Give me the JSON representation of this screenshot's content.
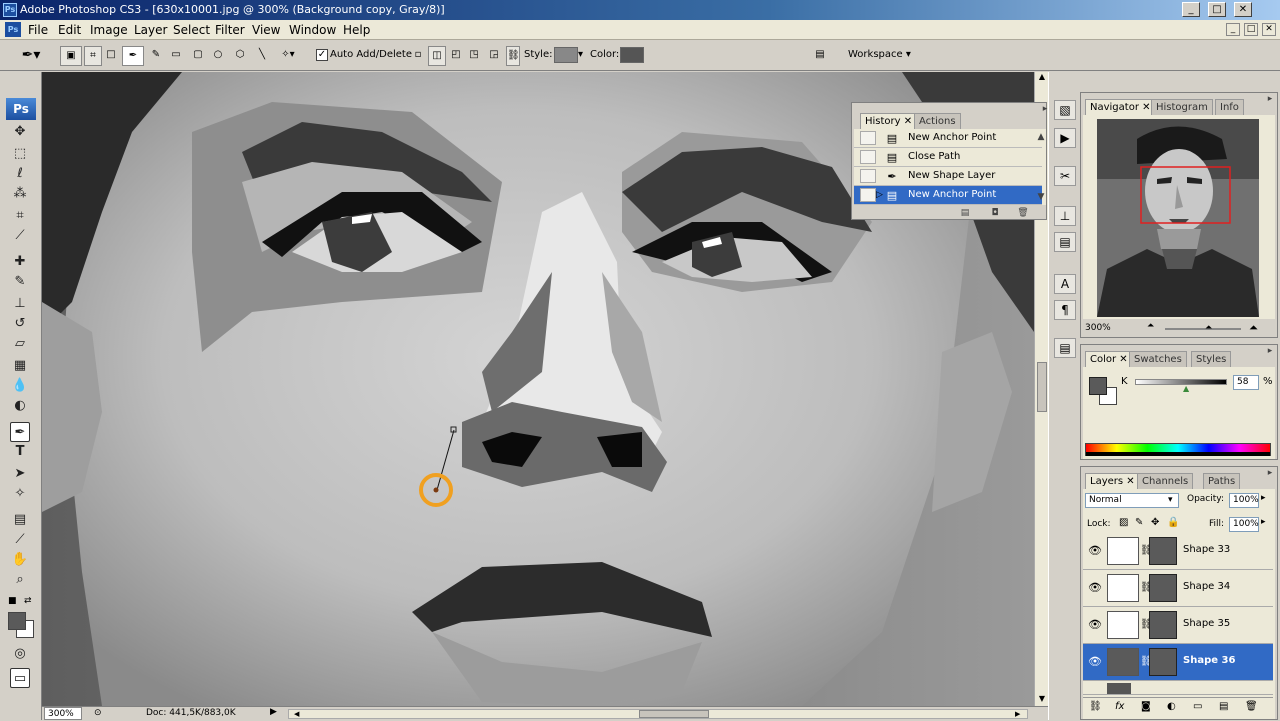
{
  "window": {
    "title": "Adobe Photoshop CS3 - [630x10001.jpg @ 300% (Background copy, Gray/8)]",
    "app_icon": "Ps"
  },
  "menu": [
    "File",
    "Edit",
    "Image",
    "Layer",
    "Select",
    "Filter",
    "View",
    "Window",
    "Help"
  ],
  "options_bar": {
    "auto_add_delete_label": "Auto Add/Delete",
    "auto_add_delete_checked": true,
    "style_label": "Style:",
    "color_label": "Color:",
    "color_value": "#5a5a5a",
    "workspace_label": "Workspace ▾"
  },
  "toolbox": {
    "logo": "Ps",
    "tools": [
      "move-icon",
      "marquee-icon",
      "lasso-icon",
      "magic-wand-icon",
      "crop-icon",
      "slice-icon",
      "healing-icon",
      "brush-icon",
      "clone-stamp-icon",
      "history-brush-icon",
      "eraser-icon",
      "gradient-icon",
      "blur-icon",
      "dodge-icon",
      "pen-icon",
      "type-icon",
      "path-selection-icon",
      "custom-shape-icon",
      "notes-icon",
      "eyedropper-icon",
      "hand-icon",
      "zoom-icon"
    ],
    "selected_tool": "pen-icon",
    "foreground_color": "#5a5a5a",
    "background_color": "#ffffff"
  },
  "status": {
    "zoom": "300%",
    "doc": "Doc: 441,5K/883,0K"
  },
  "history_panel": {
    "tabs": [
      "History",
      "Actions"
    ],
    "items": [
      {
        "label": "New Anchor Point",
        "icon": "anchor-point-icon",
        "selected": false
      },
      {
        "label": "Close Path",
        "icon": "anchor-point-icon",
        "selected": false
      },
      {
        "label": "New Shape Layer",
        "icon": "pen-icon",
        "selected": false
      },
      {
        "label": "New Anchor Point",
        "icon": "anchor-point-icon",
        "selected": true
      }
    ]
  },
  "navigator_panel": {
    "tabs": [
      "Navigator",
      "Histogram",
      "Info"
    ],
    "zoom": "300%"
  },
  "color_panel": {
    "tabs": [
      "Color",
      "Swatches",
      "Styles"
    ],
    "channel": "K",
    "value": "58",
    "unit": "%"
  },
  "layers_panel": {
    "tabs": [
      "Layers",
      "Channels",
      "Paths"
    ],
    "blend_mode": "Normal",
    "opacity_label": "Opacity:",
    "opacity": "100%",
    "lock_label": "Lock:",
    "fill_label": "Fill:",
    "fill": "100%",
    "layers": [
      {
        "name": "Shape 33",
        "selected": false
      },
      {
        "name": "Shape 34",
        "selected": false
      },
      {
        "name": "Shape 35",
        "selected": false
      },
      {
        "name": "Shape 36",
        "selected": true
      }
    ]
  }
}
